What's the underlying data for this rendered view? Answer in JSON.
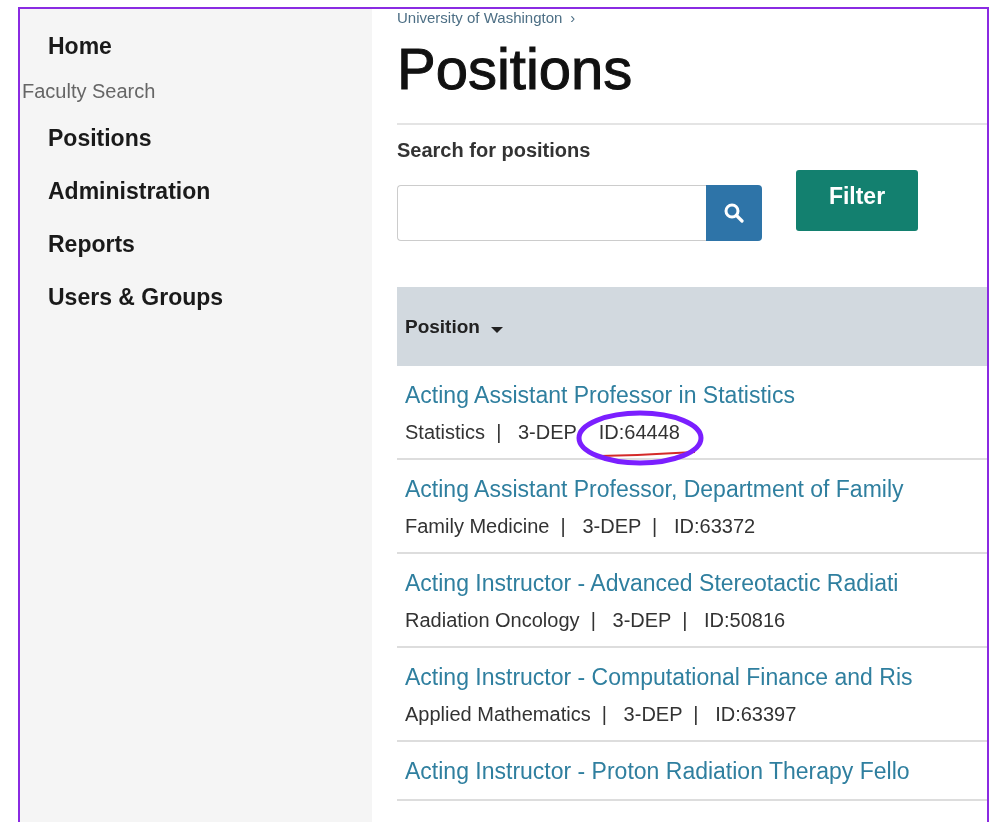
{
  "sidebar": {
    "items": [
      {
        "label": "Home",
        "kind": "link"
      },
      {
        "label": "Faculty Search",
        "kind": "heading"
      },
      {
        "label": "Positions",
        "kind": "link"
      },
      {
        "label": "Administration",
        "kind": "link"
      },
      {
        "label": "Reports",
        "kind": "link"
      },
      {
        "label": "Users & Groups",
        "kind": "link"
      }
    ]
  },
  "breadcrumb": {
    "label": "University of Washington",
    "separator": "›"
  },
  "page_title": "Positions",
  "search": {
    "label": "Search for positions"
  },
  "filter_button": "Filter",
  "table": {
    "columns": [
      {
        "label": "Position",
        "sorted": true
      }
    ],
    "rows": [
      {
        "title": "Acting Assistant Professor in Statistics",
        "meta": "Statistics  |   3-DEP    ID:64448",
        "annotated": true
      },
      {
        "title": "Acting Assistant Professor, Department of Family",
        "meta": "Family Medicine  |   3-DEP  |   ID:63372",
        "annotated": false
      },
      {
        "title": "Acting Instructor - Advanced Stereotactic Radiati",
        "meta": "Radiation Oncology  |   3-DEP  |   ID:50816",
        "annotated": false
      },
      {
        "title": "Acting Instructor - Computational Finance and Ris",
        "meta": "Applied Mathematics  |   3-DEP  |   ID:63397",
        "annotated": false
      },
      {
        "title": "Acting Instructor - Proton Radiation Therapy Fello",
        "annotated": false
      }
    ]
  }
}
